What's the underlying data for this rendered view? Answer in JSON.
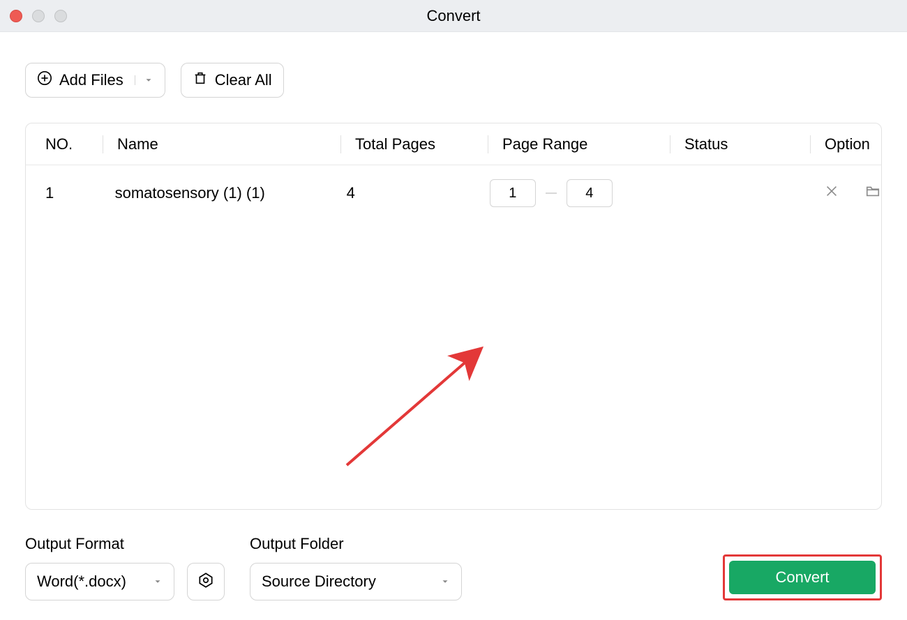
{
  "window": {
    "title": "Convert"
  },
  "toolbar": {
    "add_files_label": "Add Files",
    "clear_all_label": "Clear All"
  },
  "table": {
    "headers": {
      "no": "NO.",
      "name": "Name",
      "total_pages": "Total Pages",
      "page_range": "Page Range",
      "status": "Status",
      "option": "Option"
    },
    "rows": [
      {
        "no": "1",
        "name": "somatosensory (1) (1)",
        "total_pages": "4",
        "range_from": "1",
        "range_to": "4",
        "status": ""
      }
    ]
  },
  "bottom": {
    "output_format_label": "Output Format",
    "output_format_value": "Word(*.docx)",
    "output_folder_label": "Output Folder",
    "output_folder_value": "Source Directory",
    "convert_label": "Convert"
  },
  "colors": {
    "accent_green": "#18a864",
    "annotation_red": "#e33838"
  }
}
